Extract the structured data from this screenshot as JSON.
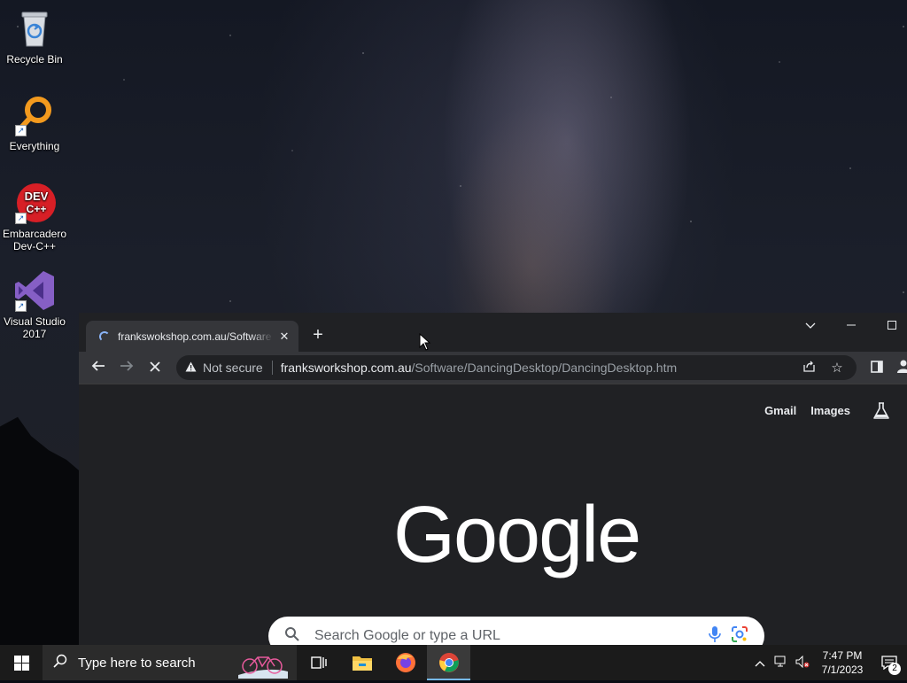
{
  "desktop": {
    "icons": [
      {
        "label": "Recycle Bin",
        "icon": "recycle-bin-icon"
      },
      {
        "label": "Everything",
        "icon": "everything-search-icon"
      },
      {
        "label": "Embarcadero Dev-C++",
        "icon": "dev-cpp-icon"
      },
      {
        "label": "Visual Studio 2017",
        "icon": "visual-studio-icon"
      }
    ]
  },
  "browser": {
    "tab": {
      "title": "frankswokshop.com.au/Software",
      "loading": true
    },
    "toolbar": {
      "security_label": "Not secure",
      "url_domain": "franksworkshop.com.au",
      "url_path": "/Software/DancingDesktop/DancingDesktop.htm"
    },
    "page": {
      "links": {
        "gmail": "Gmail",
        "images": "Images"
      },
      "logo_text": "Google",
      "search_placeholder": "Search Google or type a URL"
    }
  },
  "taskbar": {
    "search_placeholder": "Type here to search",
    "apps": [
      "task-view-icon",
      "file-explorer-icon",
      "firefox-icon",
      "chrome-icon"
    ],
    "active_app": "chrome-icon",
    "clock": {
      "time": "7:47 PM",
      "date": "7/1/2023"
    },
    "notification_count": "2"
  },
  "colors": {
    "chrome_dark": "#202124",
    "chrome_toolbar": "#35363a",
    "taskbar": "#1b1b1b",
    "accent": "#8ab4f8"
  }
}
